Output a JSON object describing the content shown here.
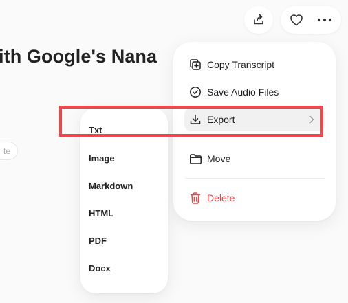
{
  "header": {
    "title": "ith Google's Nana",
    "badge": "te"
  },
  "menu": {
    "items": [
      {
        "label": "Copy Transcript",
        "icon": "copy-icon"
      },
      {
        "label": "Save Audio Files",
        "icon": "check-circle-icon"
      },
      {
        "label": "Export",
        "icon": "download-icon"
      },
      {
        "label": "Move",
        "icon": "folder-icon"
      },
      {
        "label": "Delete",
        "icon": "trash-icon"
      }
    ]
  },
  "export_submenu": {
    "items": [
      "Txt",
      "Image",
      "Markdown",
      "HTML",
      "PDF",
      "Docx"
    ]
  },
  "colors": {
    "danger": "#e5484d",
    "highlight": "#e84a4f"
  }
}
